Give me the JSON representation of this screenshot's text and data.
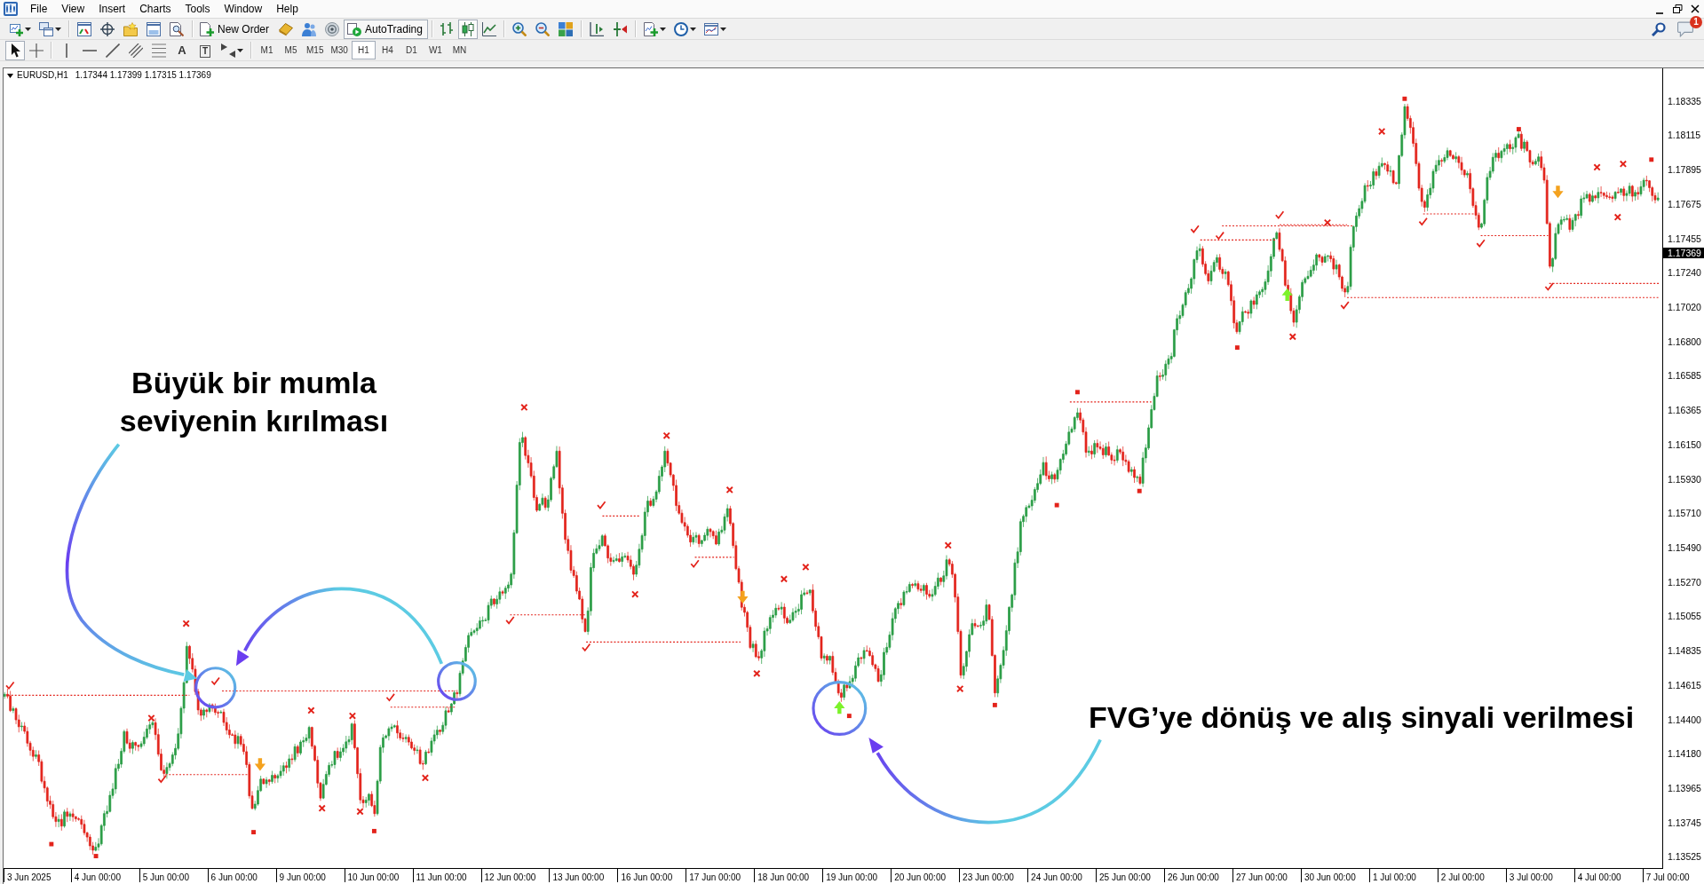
{
  "menu": [
    "File",
    "View",
    "Insert",
    "Charts",
    "Tools",
    "Window",
    "Help"
  ],
  "toolbar": {
    "new_order": "New Order",
    "auto_trading": {
      "label": "AutoTrading",
      "on": true
    },
    "chart_types": [
      {
        "kind": "bars",
        "selected": false
      },
      {
        "kind": "candles",
        "selected": true
      },
      {
        "kind": "line",
        "selected": false
      }
    ],
    "notification_count": "1"
  },
  "drawing_toolbar": {
    "pointers": [
      {
        "kind": "cursor",
        "selected": true
      },
      {
        "kind": "crosshair",
        "selected": false
      }
    ],
    "text_tool": "A",
    "label_tool": "T",
    "timeframes": [
      {
        "label": "M1",
        "selected": false
      },
      {
        "label": "M5",
        "selected": false
      },
      {
        "label": "M15",
        "selected": false
      },
      {
        "label": "M30",
        "selected": false
      },
      {
        "label": "H1",
        "selected": true
      },
      {
        "label": "H4",
        "selected": false
      },
      {
        "label": "D1",
        "selected": false
      },
      {
        "label": "W1",
        "selected": false
      },
      {
        "label": "MN",
        "selected": false
      }
    ]
  },
  "chart": {
    "symbol": "EURUSD,H1",
    "prices": "1.17344 1.17399 1.17315 1.17369",
    "price_axis": {
      "labels": [
        "1.18335",
        "1.18115",
        "1.17895",
        "1.17675",
        "1.17455",
        "1.17240",
        "1.17020",
        "1.16800",
        "1.16585",
        "1.16365",
        "1.16150",
        "1.15930",
        "1.15710",
        "1.15490",
        "1.15270",
        "1.15055",
        "1.14835",
        "1.14615",
        "1.14400",
        "1.14180",
        "1.13965",
        "1.13745",
        "1.13525"
      ],
      "current_price": "1.17369"
    },
    "time_axis": {
      "labels": [
        "3 Jun 2025",
        "4 Jun 00:00",
        "5 Jun 00:00",
        "6 Jun 00:00",
        "9 Jun 00:00",
        "10 Jun 00:00",
        "11 Jun 00:00",
        "12 Jun 00:00",
        "13 Jun 00:00",
        "16 Jun 00:00",
        "17 Jun 00:00",
        "18 Jun 00:00",
        "19 Jun 00:00",
        "20 Jun 00:00",
        "23 Jun 00:00",
        "24 Jun 00:00",
        "25 Jun 00:00",
        "26 Jun 00:00",
        "27 Jun 00:00",
        "30 Jun 00:00",
        "1 Jul 00:00",
        "2 Jul 00:00",
        "3 Jul 00:00",
        "4 Jul 00:00",
        "7 Jul 00:00"
      ]
    }
  },
  "annotations": [
    {
      "text": "Büyük bir mumla seviyenin kırılması"
    },
    {
      "text": "FVG’ye dönüş ve alış sinyali verilmesi"
    }
  ]
}
